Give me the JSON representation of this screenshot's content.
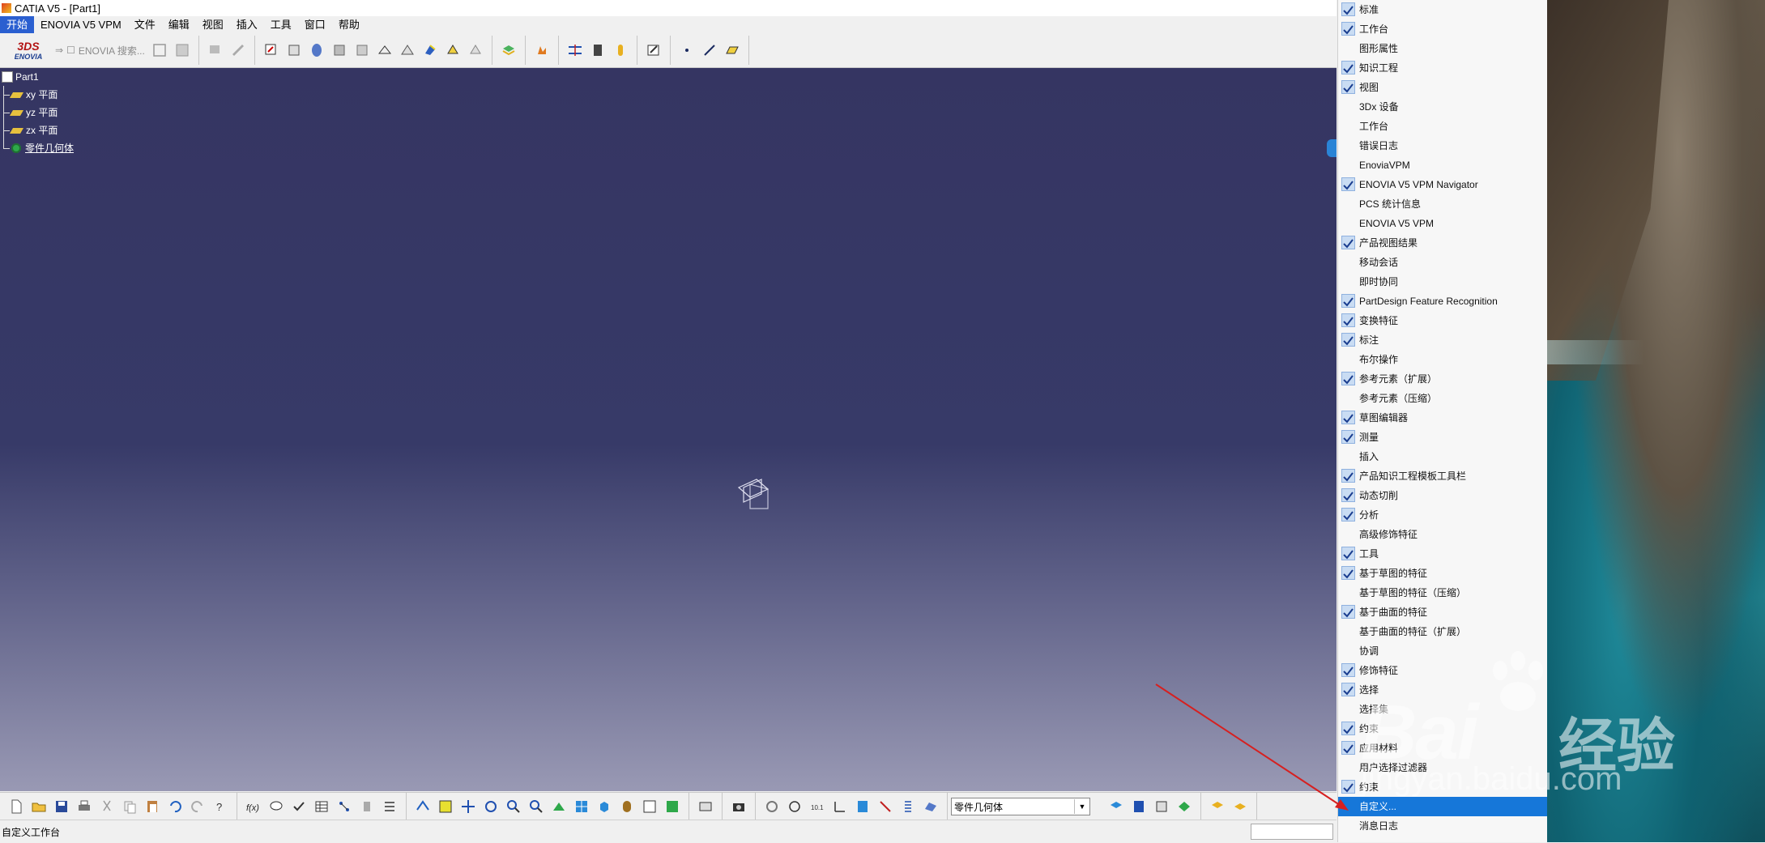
{
  "window": {
    "title": "CATIA V5 - [Part1]"
  },
  "menubar": {
    "items": [
      "开始",
      "ENOVIA V5 VPM",
      "文件",
      "编辑",
      "视图",
      "插入",
      "工具",
      "窗口",
      "帮助"
    ]
  },
  "toolbar_top": {
    "enovia_logo": "ENOVIA",
    "enovia_search": "ENOVIA 搜索..."
  },
  "spec_tree": {
    "root": "Part1",
    "children": [
      "xy 平面",
      "yz 平面",
      "zx 平面",
      "零件几何体"
    ]
  },
  "toolbar_bottom": {
    "geometry_select": "零件几何体"
  },
  "statusbar": {
    "text": "自定义工作台"
  },
  "context_menu": {
    "items": [
      {
        "label": "标准",
        "checked": true
      },
      {
        "label": "工作台",
        "checked": true
      },
      {
        "label": "图形属性",
        "checked": false
      },
      {
        "label": "知识工程",
        "checked": true
      },
      {
        "label": "视图",
        "checked": true
      },
      {
        "label": "3Dx 设备",
        "checked": false
      },
      {
        "label": "工作台",
        "checked": false
      },
      {
        "label": "错误日志",
        "checked": false
      },
      {
        "label": "EnoviaVPM",
        "checked": false
      },
      {
        "label": "ENOVIA V5 VPM Navigator",
        "checked": true
      },
      {
        "label": "PCS 统计信息",
        "checked": false
      },
      {
        "label": "ENOVIA V5 VPM",
        "checked": false
      },
      {
        "label": "产品视图结果",
        "checked": true
      },
      {
        "label": "移动会话",
        "checked": false
      },
      {
        "label": "即时协同",
        "checked": false
      },
      {
        "label": "PartDesign Feature Recognition",
        "checked": true
      },
      {
        "label": "变换特征",
        "checked": true
      },
      {
        "label": "标注",
        "checked": true
      },
      {
        "label": "布尔操作",
        "checked": false
      },
      {
        "label": "参考元素（扩展）",
        "checked": true
      },
      {
        "label": "参考元素（压缩）",
        "checked": false
      },
      {
        "label": "草图编辑器",
        "checked": true
      },
      {
        "label": "测量",
        "checked": true
      },
      {
        "label": "插入",
        "checked": false
      },
      {
        "label": "产品知识工程模板工具栏",
        "checked": true
      },
      {
        "label": "动态切削",
        "checked": true
      },
      {
        "label": "分析",
        "checked": true
      },
      {
        "label": "高级修饰特征",
        "checked": false
      },
      {
        "label": "工具",
        "checked": true
      },
      {
        "label": "基于草图的特征",
        "checked": true
      },
      {
        "label": "基于草图的特征（压缩）",
        "checked": false
      },
      {
        "label": "基于曲面的特征",
        "checked": true
      },
      {
        "label": "基于曲面的特征（扩展）",
        "checked": false
      },
      {
        "label": "协调",
        "checked": false
      },
      {
        "label": "修饰特征",
        "checked": true
      },
      {
        "label": "选择",
        "checked": true
      },
      {
        "label": "选择集",
        "checked": false
      },
      {
        "label": "约束",
        "checked": true
      },
      {
        "label": "应用材料",
        "checked": true
      },
      {
        "label": "用户选择过滤器",
        "checked": false
      },
      {
        "label": "约束",
        "checked": true
      },
      {
        "label": "自定义...",
        "checked": false,
        "highlighted": true
      },
      {
        "label": "消息日志",
        "checked": false
      }
    ]
  },
  "watermark": {
    "brand": "Bai",
    "brand_suffix": "经验",
    "domain": "jingyan.baidu.com"
  },
  "colors": {
    "viewport_top": "#353562",
    "viewport_bottom": "#9999b4",
    "menu_highlight": "#1677d9",
    "annotation_arrow": "#d62020"
  }
}
